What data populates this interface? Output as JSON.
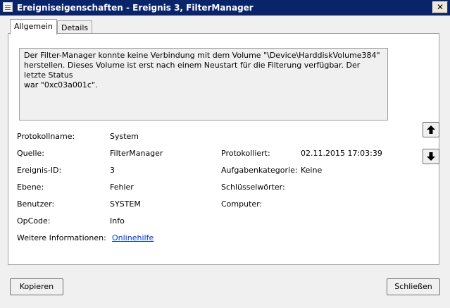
{
  "window": {
    "title": "Ereigniseigenschaften - Ereignis 3, FilterManager",
    "close_glyph": "✕"
  },
  "tabs": [
    {
      "label": "Allgemein",
      "active": true
    },
    {
      "label": "Details",
      "active": false
    }
  ],
  "description": "Der Filter-Manager konnte keine Verbindung mit dem Volume \"\\Device\\HarddiskVolume384\"\nherstellen. Dieses Volume ist erst nach einem Neustart für die Filterung verfügbar. Der letzte Status\nwar \"0xc03a001c\".",
  "fields": {
    "protokollname": {
      "label": "Protokollname:",
      "value": "System"
    },
    "quelle": {
      "label": "Quelle:",
      "value": "FilterManager"
    },
    "protokolliert": {
      "label": "Protokolliert:",
      "value": "02.11.2015 17:03:39"
    },
    "ereignis_id": {
      "label": "Ereignis-ID:",
      "value": "3"
    },
    "aufgabenkategorie": {
      "label": "Aufgabenkategorie:",
      "value": "Keine"
    },
    "ebene": {
      "label": "Ebene:",
      "value": "Fehler"
    },
    "schluesselwoerter": {
      "label": "Schlüsselwörter:",
      "value": ""
    },
    "benutzer": {
      "label": "Benutzer:",
      "value": "SYSTEM"
    },
    "computer": {
      "label": "Computer:",
      "value": ""
    },
    "opcode": {
      "label": "OpCode:",
      "value": "Info"
    },
    "weitere_informationen": {
      "label": "Weitere Informationen:",
      "value": "Onlinehilfe"
    }
  },
  "side_buttons": {
    "up_icon": "arrow-up-icon",
    "down_icon": "arrow-down-icon"
  },
  "buttons": {
    "copy_label": "Kopieren",
    "close_label": "Schließen"
  },
  "colors": {
    "titlebar": "#0a246a",
    "link": "#0033cc"
  }
}
